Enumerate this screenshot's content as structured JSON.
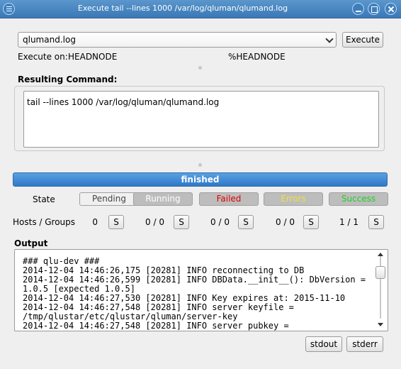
{
  "window": {
    "title": "Execute tail --lines 1000 /var/log/qluman/qlumand.log",
    "icon": "menu-icon",
    "controls": [
      "minimize-icon",
      "maximize-icon",
      "close-icon"
    ]
  },
  "command_select": {
    "selected": "qlumand.log"
  },
  "execute_button": "Execute",
  "execute_on": {
    "label": "Execute on:",
    "host": "HEADNODE",
    "pattern": "%HEADNODE"
  },
  "resulting_command": {
    "label": "Resulting Command:",
    "value": "tail --lines 1000 /var/log/qluman/qlumand.log"
  },
  "progress": {
    "text": "finished",
    "value": 1.0
  },
  "state": {
    "label": "State",
    "items": [
      {
        "label": "Pending",
        "color": "#444444"
      },
      {
        "label": "Running",
        "color": "#ffffff"
      },
      {
        "label": "Failed",
        "color": "#e00000"
      },
      {
        "label": "Errors",
        "color": "#f0e040"
      },
      {
        "label": "Success",
        "color": "#20d020"
      }
    ]
  },
  "hosts_groups": {
    "label": "Hosts / Groups",
    "counts": [
      "0",
      "0 / 0",
      "0 / 0",
      "0 / 0",
      "1 / 1"
    ],
    "button": "S"
  },
  "output": {
    "label": "Output",
    "lines": [
      "### qlu-dev ###",
      "2014-12-04 14:46:26,175 [20281] INFO reconnecting to DB",
      "2014-12-04 14:46:26,599 [20281] INFO DBData.__init__(): DbVersion =",
      "1.0.5 [expected 1.0.5]",
      "2014-12-04 14:46:27,530 [20281] INFO Key expires at: 2015-11-10",
      "2014-12-04 14:46:27,548 [20281] INFO server keyfile =",
      "/tmp/qlustar/etc/qlustar/qluman/server-key",
      "2014-12-04 14:46:27,548 [20281] INFO server pubkey ="
    ]
  },
  "stream_buttons": {
    "stdout": "stdout",
    "stderr": "stderr"
  }
}
